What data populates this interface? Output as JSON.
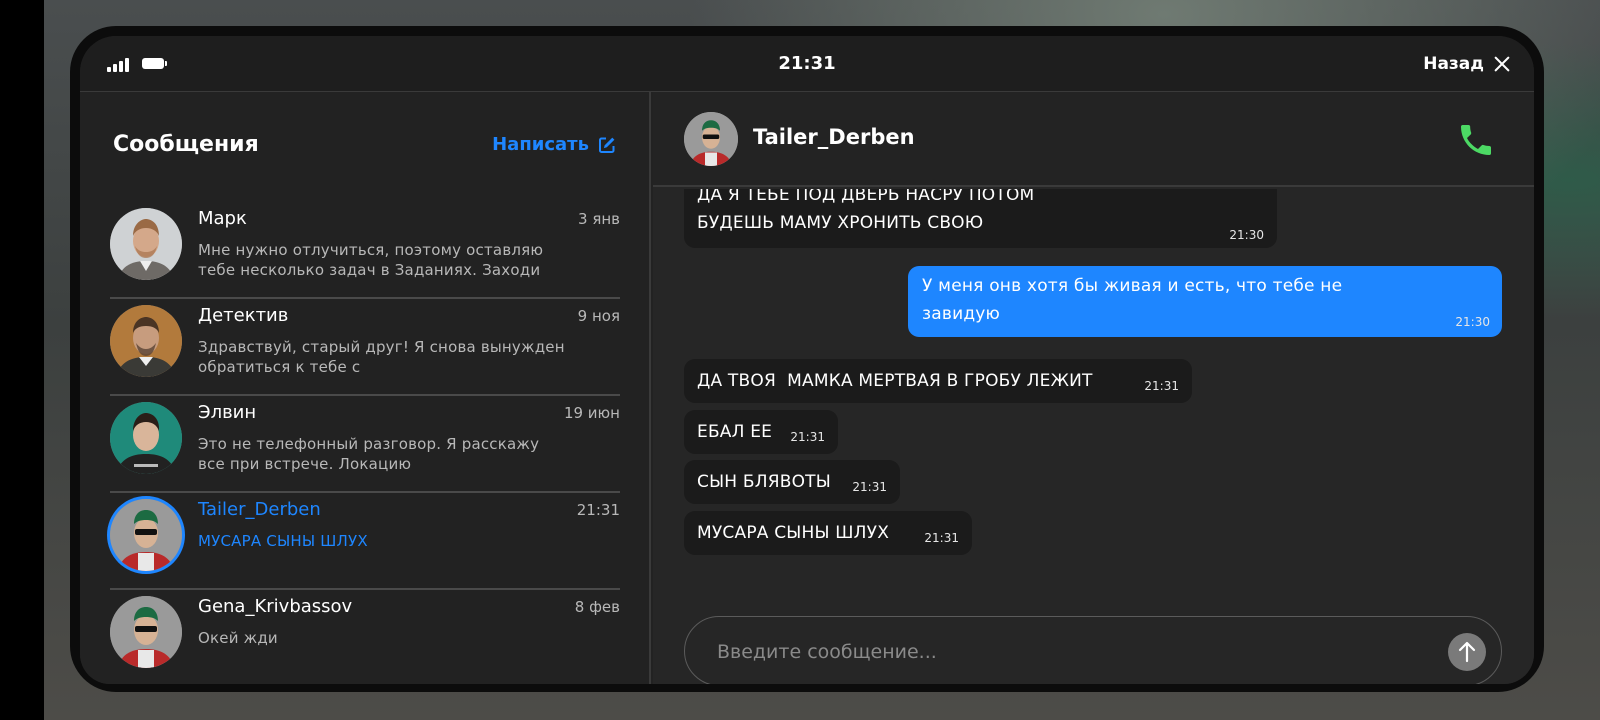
{
  "status_bar": {
    "time": "21:31",
    "back_label": "Назад"
  },
  "contacts_panel": {
    "title": "Сообщения",
    "compose_label": "Написать",
    "contacts": [
      {
        "name": "Марк",
        "date": "3 янв",
        "preview": "Мне нужно отлучиться, поэтому оставляю тебе несколько задач в Заданиях. Заходи"
      },
      {
        "name": "Детектив",
        "date": "9 ноя",
        "preview": "Здравствуй, старый друг! Я снова вынужден обратиться к тебе с"
      },
      {
        "name": "Элвин",
        "date": "19 июн",
        "preview": "Это не телефонный разговор. Я расскажу все при встрече. Локацию"
      },
      {
        "name": "Tailer_Derben",
        "date": "21:31",
        "preview": "МУСАРА СЫНЫ ШЛУХ",
        "active": true
      },
      {
        "name": "Gena_Krivbassov",
        "date": "8 фев",
        "preview": "Окей жди"
      }
    ]
  },
  "chat": {
    "contact_name": "Tailer_Derben",
    "messages": [
      {
        "text": "ДА Я ТЕБЕ ПОД ДВЕРЬ НАСРУ ПОТОМ БУДЕШЬ МАМУ ХРОНИТЬ СВОЮ",
        "time": "21:30",
        "direction": "incoming"
      },
      {
        "text": "У меня онв хотя бы живая и есть, что тебе не завидую",
        "time": "21:30",
        "direction": "outgoing"
      },
      {
        "text": "ДА ТВОЯ  МАМКА МЕРТВАЯ В ГРОБУ ЛЕЖИТ",
        "time": "21:31",
        "direction": "incoming"
      },
      {
        "text": "ЕБАЛ ЕЕ",
        "time": "21:31",
        "direction": "incoming"
      },
      {
        "text": "СЫН БЛЯВОТЫ",
        "time": "21:31",
        "direction": "incoming"
      },
      {
        "text": "МУСАРА СЫНЫ ШЛУХ",
        "time": "21:31",
        "direction": "incoming"
      }
    ],
    "input_placeholder": "Введите сообщение..."
  },
  "colors": {
    "accent": "#1e86ff",
    "call_green": "#4cd964",
    "panel": "#222222"
  },
  "icons": [
    "signal-icon",
    "battery-icon",
    "close-icon",
    "compose-icon",
    "phone-call-icon",
    "send-arrow-icon"
  ]
}
